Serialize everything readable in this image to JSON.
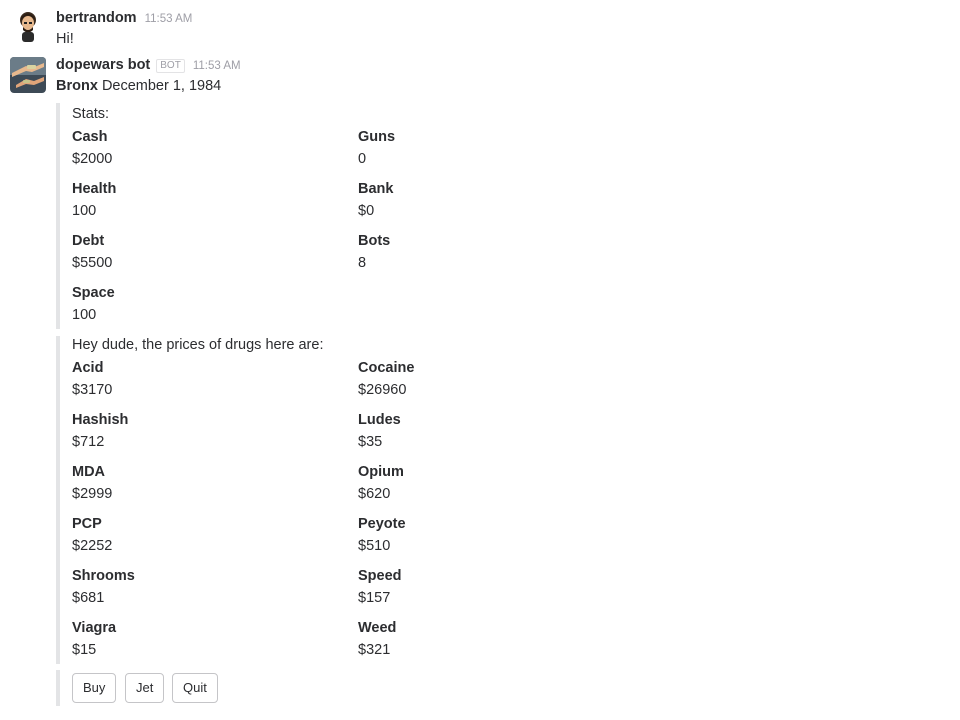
{
  "messages": [
    {
      "username": "bertrandom",
      "timestamp": "11:53 AM",
      "text": "Hi!",
      "avatar_icon": "user-avatar-icon"
    },
    {
      "username": "dopewars bot",
      "badge": "BOT",
      "timestamp": "11:53 AM",
      "location": "Bronx",
      "date": "December 1, 1984",
      "avatar_icon": "bot-avatar-icon"
    }
  ],
  "stats": {
    "pretext": "Stats:",
    "fields": [
      {
        "title": "Cash",
        "value": "$2000"
      },
      {
        "title": "Guns",
        "value": "0"
      },
      {
        "title": "Health",
        "value": "100"
      },
      {
        "title": "Bank",
        "value": "$0"
      },
      {
        "title": "Debt",
        "value": "$5500"
      },
      {
        "title": "Bots",
        "value": "8"
      },
      {
        "title": "Space",
        "value": "100"
      }
    ]
  },
  "prices": {
    "pretext": "Hey dude, the prices of drugs here are:",
    "fields": [
      {
        "title": "Acid",
        "value": "$3170"
      },
      {
        "title": "Cocaine",
        "value": "$26960"
      },
      {
        "title": "Hashish",
        "value": "$712"
      },
      {
        "title": "Ludes",
        "value": "$35"
      },
      {
        "title": "MDA",
        "value": "$2999"
      },
      {
        "title": "Opium",
        "value": "$620"
      },
      {
        "title": "PCP",
        "value": "$2252"
      },
      {
        "title": "Peyote",
        "value": "$510"
      },
      {
        "title": "Shrooms",
        "value": "$681"
      },
      {
        "title": "Speed",
        "value": "$157"
      },
      {
        "title": "Viagra",
        "value": "$15"
      },
      {
        "title": "Weed",
        "value": "$321"
      }
    ]
  },
  "actions": {
    "buy_label": "Buy",
    "jet_label": "Jet",
    "quit_label": "Quit"
  },
  "colors": {
    "text": "#2c2d30",
    "muted": "#9e9ea6",
    "attachment_bar": "#e3e4e6"
  }
}
